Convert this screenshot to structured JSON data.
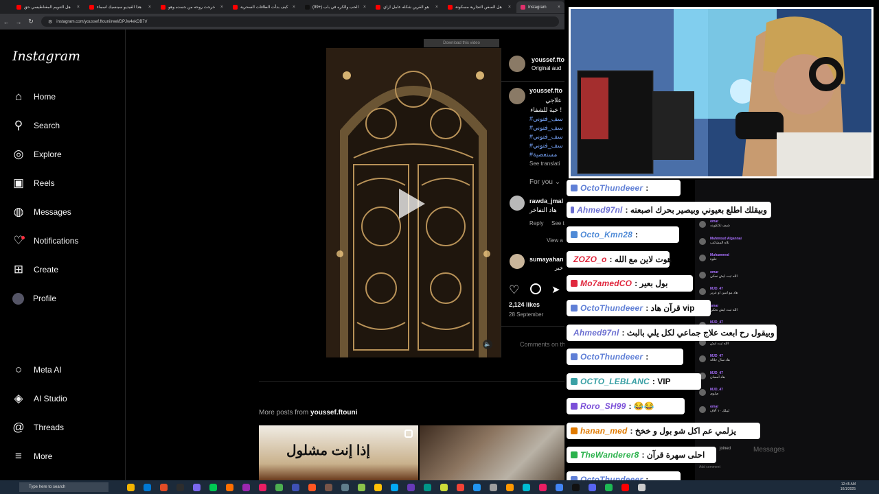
{
  "browser": {
    "tabs": [
      {
        "label": "هل التنويم المغناطيسي حق",
        "color": "#ff0000"
      },
      {
        "label": "هذا الفيديو سينسيك اسماء",
        "color": "#ff0000"
      },
      {
        "label": "خرجت روحه من جسده وهو",
        "color": "#ff0000"
      },
      {
        "label": "كيف بدأت الطاقات السحرية",
        "color": "#ff0000"
      },
      {
        "label": "(99+) الحب والكره في باب",
        "color": "#111111"
      },
      {
        "label": "هو القرين شكله عامل ازاي",
        "color": "#ff0000"
      },
      {
        "label": "هل السفن التجارية مسكونة",
        "color": "#ff0000"
      },
      {
        "label": "Instagram",
        "color": "#e1306c"
      }
    ],
    "url": "instagram.com/youssef.ftouni/reel/DPJw4ekDB7r/"
  },
  "sidebar": {
    "logo": "Instagram",
    "items": [
      {
        "label": "Home",
        "icon": "home-icon"
      },
      {
        "label": "Search",
        "icon": "search-icon"
      },
      {
        "label": "Explore",
        "icon": "compass-icon"
      },
      {
        "label": "Reels",
        "icon": "reels-icon"
      },
      {
        "label": "Messages",
        "icon": "messenger-icon"
      },
      {
        "label": "Notifications",
        "icon": "heart-icon"
      },
      {
        "label": "Create",
        "icon": "plus-square-icon"
      },
      {
        "label": "Profile",
        "icon": "avatar-icon"
      }
    ],
    "bottom_items": [
      {
        "label": "Meta AI",
        "icon": "meta-ai-icon"
      },
      {
        "label": "AI Studio",
        "icon": "ai-studio-icon"
      },
      {
        "label": "Threads",
        "icon": "threads-icon"
      },
      {
        "label": "More",
        "icon": "menu-icon"
      }
    ]
  },
  "video": {
    "download_label": "Download this video"
  },
  "post": {
    "author": "youssef.fto",
    "audio": "Original aud",
    "caption_author": "youssef.fto",
    "caption_lines": [
      "علاجي",
      "خية للشفاء !"
    ],
    "hashtags": [
      "#سف_فتوني",
      "#سف_فتوني",
      "#سف_فتوني",
      "#سف_فتوني",
      "#مستعصية"
    ],
    "see_translation": "See translati",
    "for_you": "For you",
    "comments": [
      {
        "user": "rawda_jmal",
        "text": "هاد التفاخر",
        "reply": "Reply",
        "see_translation": "See tra",
        "view": "View a"
      },
      {
        "user": "sumayahan",
        "text": "الله ربنا كل خير"
      }
    ],
    "likes": "2,124 likes",
    "date": "28 September",
    "comments_limited": "Comments on this post have been limited."
  },
  "more_posts": {
    "prefix": "More posts from",
    "author": "youssef.ftouni",
    "thumb1_text": "إذا إنت مشلول"
  },
  "overlay_chat": [
    {
      "user": "OctoThundeeer",
      "text": ":",
      "color": "#5f7fd6"
    },
    {
      "user": "Ahmed97nl",
      "text": ": وبيقلك اطلع بعيوني وبيصير بحرك اصبعته",
      "color": "#6b6fd1"
    },
    {
      "user": "Octo_Kmn28",
      "text": ":",
      "color": "#4f8ad6"
    },
    {
      "user": "ZOZO_o",
      "text": ": هوت لاين مع الله",
      "color": "#e0283e"
    },
    {
      "user": "Mo7amedCO",
      "text": ": بول بعير",
      "color": "#e0283e"
    },
    {
      "user": "OctoThundeeer",
      "text": ": قرآن هاد vip",
      "color": "#5f7fd6"
    },
    {
      "user": "Ahmed97nl",
      "text": ": وبيقول رح ابعت علاج جماعي لكل يلي بالبث",
      "color": "#6b6fd1"
    },
    {
      "user": "OctoThundeeer",
      "text": ":",
      "color": "#5f7fd6"
    },
    {
      "user": "OCTO_LEBLANC",
      "text": ": VIP",
      "color": "#3aa0a5"
    },
    {
      "user": "Roro_SH99",
      "text": ": 😂😂",
      "color": "#7b4fd8"
    },
    {
      "user": "hanan_med",
      "text": ": يزلمي عم اكل شو بول و خخخ",
      "color": "#e07a00"
    },
    {
      "user": "TheWanderer8",
      "text": ": احلى سهرة قرآن",
      "color": "#2bb24c"
    },
    {
      "user": "OctoThundeeer",
      "text": ":",
      "color": "#5f7fd6"
    }
  ],
  "twitch_chat": [
    {
      "name": "omar",
      "text": "شيف تكتكوينه"
    },
    {
      "name": "Mahmoud Algannai",
      "text": "تلاه المشاغب"
    },
    {
      "name": "Muhammed",
      "text": "حلوة"
    },
    {
      "name": "omar",
      "text": "الله ثبت ايش نحكي"
    },
    {
      "name": "MJD_47",
      "text": "هاد مو امين او عزيز"
    },
    {
      "name": "omar",
      "text": "الله ثبت ايش نحكي"
    },
    {
      "name": "MJD_47",
      "text": "هاد عنده فكرة"
    },
    {
      "name": "omar",
      "text": "الله ثبت ايش"
    },
    {
      "name": "MJD_47",
      "text": "هاد سال جلالة"
    },
    {
      "name": "MJD_47",
      "text": "هاد امسان"
    },
    {
      "name": "MJD_47",
      "text": "صلوى"
    },
    {
      "name": "omar",
      "text": "ليبلك ١٠ آلاف"
    }
  ],
  "twitch_footer": {
    "messages": "Messages",
    "joined": "joined",
    "add_comment": "Add comment"
  },
  "taskbar": {
    "search_placeholder": "Type here to search",
    "time": "12:45 AM",
    "date": "10/1/2025"
  }
}
